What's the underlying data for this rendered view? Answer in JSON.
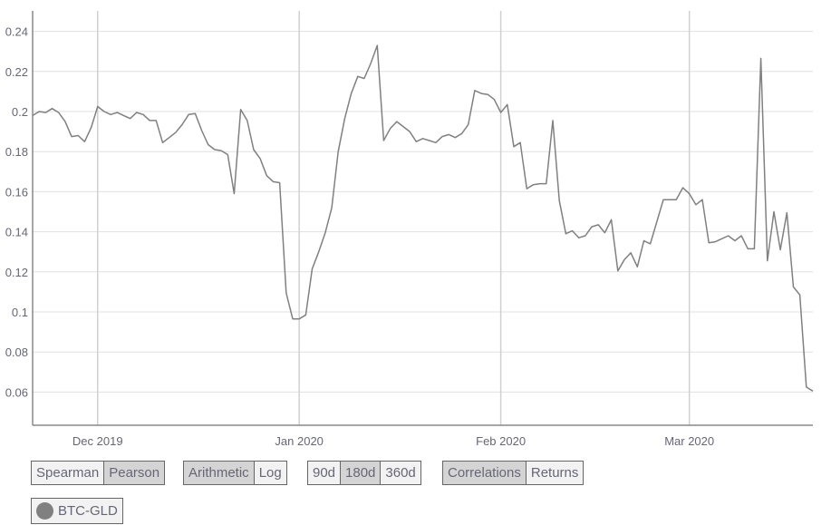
{
  "chart_data": {
    "type": "line",
    "title": "",
    "xlabel": "",
    "ylabel": "",
    "ylim": [
      0.045,
      0.25
    ],
    "yticks": [
      "0.06",
      "0.08",
      "0.1",
      "0.12",
      "0.14",
      "0.16",
      "0.18",
      "0.2",
      "0.22",
      "0.24"
    ],
    "ytick_values": [
      0.06,
      0.08,
      0.1,
      0.12,
      0.14,
      0.16,
      0.18,
      0.2,
      0.22,
      0.24
    ],
    "x_start": "2019-11-21",
    "x_end": "2020-03-20",
    "xticks": [
      {
        "label": "Dec 2019",
        "day_index": 10
      },
      {
        "label": "Jan 2020",
        "day_index": 41
      },
      {
        "label": "Feb 2020",
        "day_index": 72
      },
      {
        "label": "Mar 2020",
        "day_index": 101
      }
    ],
    "grid": true,
    "legend_position": "bottom-left",
    "series": [
      {
        "name": "BTC-GLD",
        "color": "#808080",
        "values": [
          0.198,
          0.2,
          0.1995,
          0.2015,
          0.1995,
          0.195,
          0.1875,
          0.188,
          0.185,
          0.192,
          0.2025,
          0.2,
          0.1985,
          0.1995,
          0.198,
          0.1965,
          0.1995,
          0.1985,
          0.1955,
          0.1955,
          0.1845,
          0.187,
          0.1895,
          0.1935,
          0.1985,
          0.199,
          0.1905,
          0.1835,
          0.181,
          0.1805,
          0.1785,
          0.159,
          0.201,
          0.1955,
          0.181,
          0.1765,
          0.168,
          0.165,
          0.1645,
          0.1095,
          0.0965,
          0.0965,
          0.0985,
          0.1215,
          0.13,
          0.1395,
          0.152,
          0.18,
          0.1965,
          0.209,
          0.2175,
          0.2165,
          0.224,
          0.233,
          0.1855,
          0.1915,
          0.195,
          0.1925,
          0.19,
          0.185,
          0.1865,
          0.1855,
          0.1845,
          0.1875,
          0.1885,
          0.187,
          0.189,
          0.1935,
          0.2105,
          0.209,
          0.2085,
          0.206,
          0.1995,
          0.2035,
          0.1825,
          0.1845,
          0.1615,
          0.1635,
          0.164,
          0.164,
          0.1955,
          0.1555,
          0.139,
          0.1405,
          0.137,
          0.138,
          0.1425,
          0.1435,
          0.1395,
          0.146,
          0.1205,
          0.126,
          0.1295,
          0.1225,
          0.1355,
          0.134,
          0.145,
          0.156,
          0.156,
          0.156,
          0.162,
          0.159,
          0.1535,
          0.156,
          0.1345,
          0.135,
          0.1365,
          0.138,
          0.1355,
          0.138,
          0.1315,
          0.1315,
          0.2265,
          0.1255,
          0.15,
          0.131,
          0.1495,
          0.1125,
          0.1085,
          0.0625,
          0.0605
        ]
      }
    ]
  },
  "controls": {
    "method": {
      "options": [
        {
          "label": "Spearman",
          "active": false
        },
        {
          "label": "Pearson",
          "active": true
        }
      ]
    },
    "scale": {
      "options": [
        {
          "label": "Arithmetic",
          "active": true
        },
        {
          "label": "Log",
          "active": false
        }
      ]
    },
    "window": {
      "options": [
        {
          "label": "90d",
          "active": false
        },
        {
          "label": "180d",
          "active": true
        },
        {
          "label": "360d",
          "active": false
        }
      ]
    },
    "view": {
      "options": [
        {
          "label": "Correlations",
          "active": true
        },
        {
          "label": "Returns",
          "active": false
        }
      ]
    }
  },
  "legend": {
    "items": [
      {
        "label": "BTC-GLD",
        "color": "#808080",
        "icon": "circle-swatch-icon"
      }
    ]
  }
}
